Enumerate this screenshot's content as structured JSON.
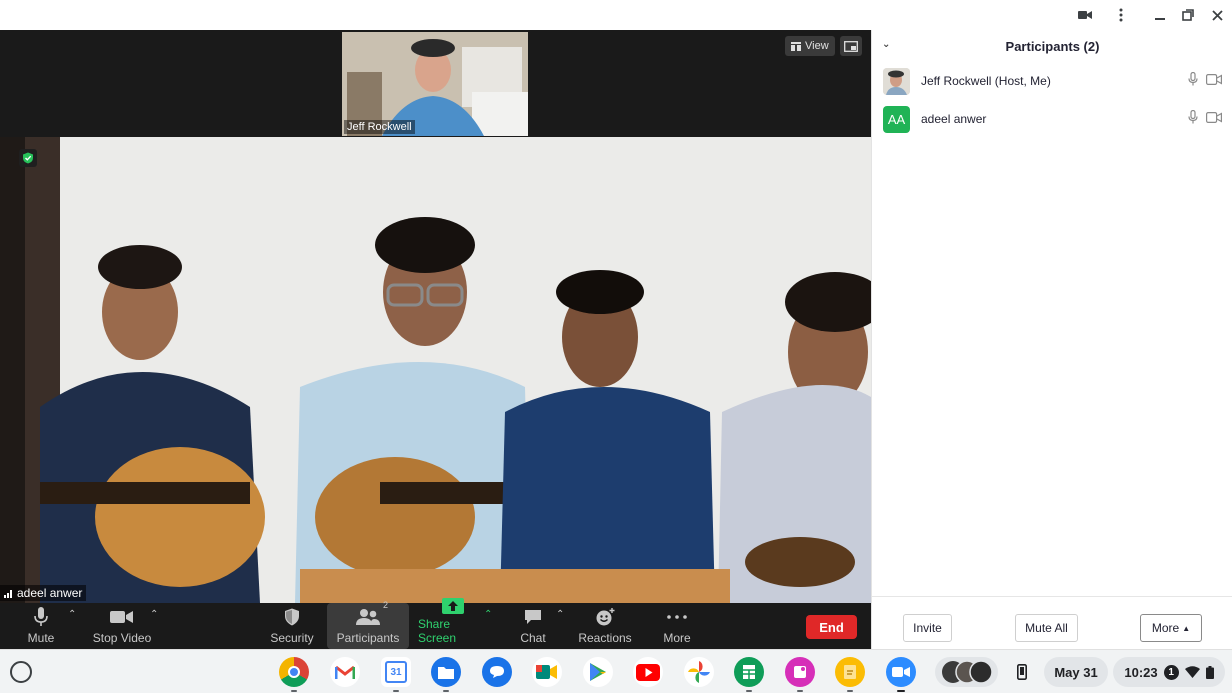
{
  "window": {
    "controls": [
      "camera-icon",
      "kebab-menu-icon",
      "minimize-icon",
      "restore-icon",
      "close-icon"
    ]
  },
  "meeting": {
    "thumbnail_name": "Jeff Rockwell",
    "view_label": "View",
    "speaker_name": "adeel anwer"
  },
  "toolbar": {
    "mute": "Mute",
    "stop_video": "Stop Video",
    "security": "Security",
    "participants": "Participants",
    "participants_count": "2",
    "share_screen": "Share Screen",
    "chat": "Chat",
    "reactions": "Reactions",
    "more": "More",
    "end": "End"
  },
  "panel": {
    "title": "Participants (2)",
    "participants": [
      {
        "name": "Jeff Rockwell (Host, Me)",
        "avatar": "photo"
      },
      {
        "name": "adeel anwer",
        "avatar": "AA",
        "avatar_color": "#20b356"
      }
    ],
    "invite": "Invite",
    "mute_all": "Mute All",
    "more": "More"
  },
  "shelf": {
    "apps": [
      "chrome-icon",
      "gmail-icon",
      "calendar-icon",
      "files-icon",
      "messages-icon",
      "meet-icon",
      "play-store-icon",
      "youtube-icon",
      "photos-icon",
      "sheets-icon",
      "canvas-icon",
      "keep-icon",
      "zoom-icon"
    ],
    "calendar_day": "31",
    "date": "May 31",
    "time": "10:23",
    "notification_count": "1"
  },
  "colors": {
    "end": "#e02828",
    "share_green": "#2fd16e",
    "zoom_blue": "#2d8cff"
  }
}
